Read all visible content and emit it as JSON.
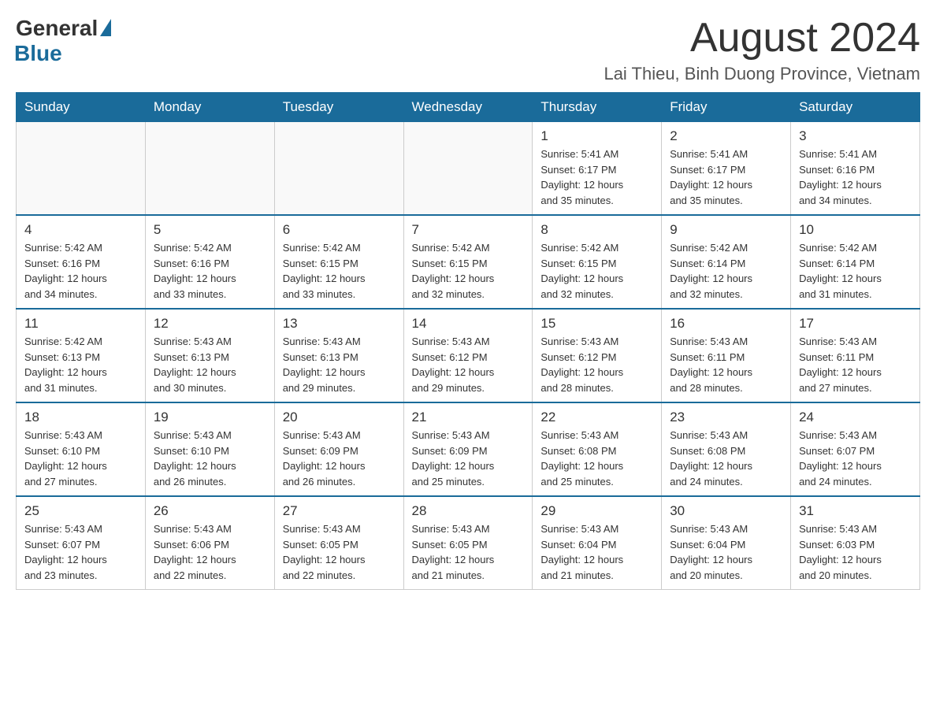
{
  "logo": {
    "general": "General",
    "blue": "Blue"
  },
  "title": "August 2024",
  "location": "Lai Thieu, Binh Duong Province, Vietnam",
  "headers": [
    "Sunday",
    "Monday",
    "Tuesday",
    "Wednesday",
    "Thursday",
    "Friday",
    "Saturday"
  ],
  "weeks": [
    [
      {
        "day": "",
        "info": ""
      },
      {
        "day": "",
        "info": ""
      },
      {
        "day": "",
        "info": ""
      },
      {
        "day": "",
        "info": ""
      },
      {
        "day": "1",
        "info": "Sunrise: 5:41 AM\nSunset: 6:17 PM\nDaylight: 12 hours\nand 35 minutes."
      },
      {
        "day": "2",
        "info": "Sunrise: 5:41 AM\nSunset: 6:17 PM\nDaylight: 12 hours\nand 35 minutes."
      },
      {
        "day": "3",
        "info": "Sunrise: 5:41 AM\nSunset: 6:16 PM\nDaylight: 12 hours\nand 34 minutes."
      }
    ],
    [
      {
        "day": "4",
        "info": "Sunrise: 5:42 AM\nSunset: 6:16 PM\nDaylight: 12 hours\nand 34 minutes."
      },
      {
        "day": "5",
        "info": "Sunrise: 5:42 AM\nSunset: 6:16 PM\nDaylight: 12 hours\nand 33 minutes."
      },
      {
        "day": "6",
        "info": "Sunrise: 5:42 AM\nSunset: 6:15 PM\nDaylight: 12 hours\nand 33 minutes."
      },
      {
        "day": "7",
        "info": "Sunrise: 5:42 AM\nSunset: 6:15 PM\nDaylight: 12 hours\nand 32 minutes."
      },
      {
        "day": "8",
        "info": "Sunrise: 5:42 AM\nSunset: 6:15 PM\nDaylight: 12 hours\nand 32 minutes."
      },
      {
        "day": "9",
        "info": "Sunrise: 5:42 AM\nSunset: 6:14 PM\nDaylight: 12 hours\nand 32 minutes."
      },
      {
        "day": "10",
        "info": "Sunrise: 5:42 AM\nSunset: 6:14 PM\nDaylight: 12 hours\nand 31 minutes."
      }
    ],
    [
      {
        "day": "11",
        "info": "Sunrise: 5:42 AM\nSunset: 6:13 PM\nDaylight: 12 hours\nand 31 minutes."
      },
      {
        "day": "12",
        "info": "Sunrise: 5:43 AM\nSunset: 6:13 PM\nDaylight: 12 hours\nand 30 minutes."
      },
      {
        "day": "13",
        "info": "Sunrise: 5:43 AM\nSunset: 6:13 PM\nDaylight: 12 hours\nand 29 minutes."
      },
      {
        "day": "14",
        "info": "Sunrise: 5:43 AM\nSunset: 6:12 PM\nDaylight: 12 hours\nand 29 minutes."
      },
      {
        "day": "15",
        "info": "Sunrise: 5:43 AM\nSunset: 6:12 PM\nDaylight: 12 hours\nand 28 minutes."
      },
      {
        "day": "16",
        "info": "Sunrise: 5:43 AM\nSunset: 6:11 PM\nDaylight: 12 hours\nand 28 minutes."
      },
      {
        "day": "17",
        "info": "Sunrise: 5:43 AM\nSunset: 6:11 PM\nDaylight: 12 hours\nand 27 minutes."
      }
    ],
    [
      {
        "day": "18",
        "info": "Sunrise: 5:43 AM\nSunset: 6:10 PM\nDaylight: 12 hours\nand 27 minutes."
      },
      {
        "day": "19",
        "info": "Sunrise: 5:43 AM\nSunset: 6:10 PM\nDaylight: 12 hours\nand 26 minutes."
      },
      {
        "day": "20",
        "info": "Sunrise: 5:43 AM\nSunset: 6:09 PM\nDaylight: 12 hours\nand 26 minutes."
      },
      {
        "day": "21",
        "info": "Sunrise: 5:43 AM\nSunset: 6:09 PM\nDaylight: 12 hours\nand 25 minutes."
      },
      {
        "day": "22",
        "info": "Sunrise: 5:43 AM\nSunset: 6:08 PM\nDaylight: 12 hours\nand 25 minutes."
      },
      {
        "day": "23",
        "info": "Sunrise: 5:43 AM\nSunset: 6:08 PM\nDaylight: 12 hours\nand 24 minutes."
      },
      {
        "day": "24",
        "info": "Sunrise: 5:43 AM\nSunset: 6:07 PM\nDaylight: 12 hours\nand 24 minutes."
      }
    ],
    [
      {
        "day": "25",
        "info": "Sunrise: 5:43 AM\nSunset: 6:07 PM\nDaylight: 12 hours\nand 23 minutes."
      },
      {
        "day": "26",
        "info": "Sunrise: 5:43 AM\nSunset: 6:06 PM\nDaylight: 12 hours\nand 22 minutes."
      },
      {
        "day": "27",
        "info": "Sunrise: 5:43 AM\nSunset: 6:05 PM\nDaylight: 12 hours\nand 22 minutes."
      },
      {
        "day": "28",
        "info": "Sunrise: 5:43 AM\nSunset: 6:05 PM\nDaylight: 12 hours\nand 21 minutes."
      },
      {
        "day": "29",
        "info": "Sunrise: 5:43 AM\nSunset: 6:04 PM\nDaylight: 12 hours\nand 21 minutes."
      },
      {
        "day": "30",
        "info": "Sunrise: 5:43 AM\nSunset: 6:04 PM\nDaylight: 12 hours\nand 20 minutes."
      },
      {
        "day": "31",
        "info": "Sunrise: 5:43 AM\nSunset: 6:03 PM\nDaylight: 12 hours\nand 20 minutes."
      }
    ]
  ]
}
